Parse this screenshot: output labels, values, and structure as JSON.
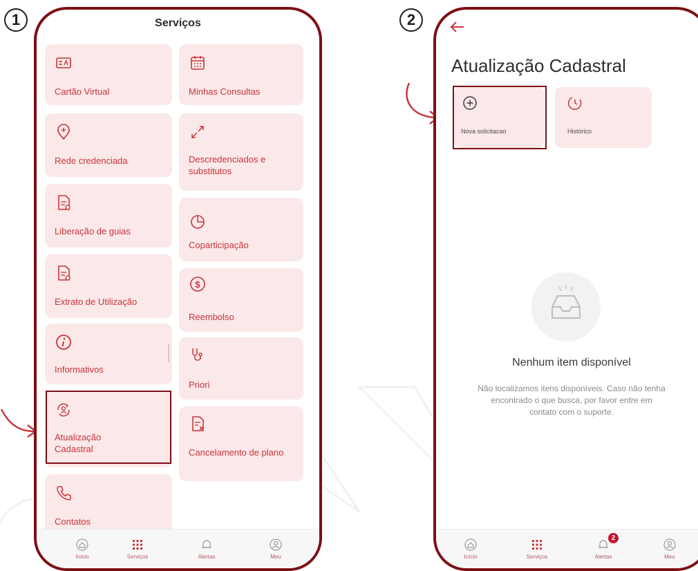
{
  "steps": [
    "1",
    "2"
  ],
  "colors": {
    "accent": "#c8343c",
    "frame": "#7d0f15",
    "tile_bg": "#fbe8e8",
    "badge": "#c8102e"
  },
  "screen1": {
    "title": "Serviços",
    "left_column": [
      {
        "label": "Cartão Virtual",
        "icon": "card-icon"
      },
      {
        "label": "Rede credenciada",
        "icon": "map-pin-icon"
      },
      {
        "label": "Liberação de guias",
        "icon": "document-icon"
      },
      {
        "label": "Extrato de Utilização",
        "icon": "document-icon"
      },
      {
        "label": "Informativos",
        "icon": "info-icon"
      },
      {
        "label": "Atualização Cadastral",
        "icon": "user-sync-icon"
      },
      {
        "label": "Contatos",
        "icon": "phone-icon"
      }
    ],
    "right_column": [
      {
        "label": "Minhas Consultas",
        "icon": "calendar-icon"
      },
      {
        "label": "Descredenciados e substitutos",
        "icon": "arrows-diagonal-icon"
      },
      {
        "label": "Coparticipação",
        "icon": "pie-chart-icon"
      },
      {
        "label": "Reembolso",
        "icon": "money-icon"
      },
      {
        "label": "Priori",
        "icon": "stethoscope-icon"
      },
      {
        "label": "Cancelamento de plano",
        "icon": "document-cancel-icon"
      }
    ],
    "nav": {
      "items": [
        {
          "label": "Início",
          "icon": "home-icon"
        },
        {
          "label": "Serviços",
          "icon": "grid-icon"
        },
        {
          "label": "Alertas",
          "icon": "bell-icon"
        },
        {
          "label": "Meu",
          "icon": "user-icon"
        }
      ]
    }
  },
  "screen2": {
    "back_icon": "arrow-left-icon",
    "title": "Atualização Cadastral",
    "actions": [
      {
        "label": "Nova solicitacao",
        "icon": "plus-circle-icon"
      },
      {
        "label": "Histórico",
        "icon": "history-icon"
      }
    ],
    "empty": {
      "icon": "inbox-icon",
      "title": "Nenhum item disponível",
      "text": "Não localizamos itens disponíveis. Caso não tenha encontrado o que busca, por favor entre em contato com o suporte."
    },
    "nav": {
      "items": [
        {
          "label": "Início",
          "icon": "home-icon"
        },
        {
          "label": "Serviços",
          "icon": "grid-icon"
        },
        {
          "label": "Alertas",
          "icon": "bell-icon"
        },
        {
          "label": "Meu",
          "icon": "user-icon"
        }
      ],
      "badge": "2"
    }
  }
}
